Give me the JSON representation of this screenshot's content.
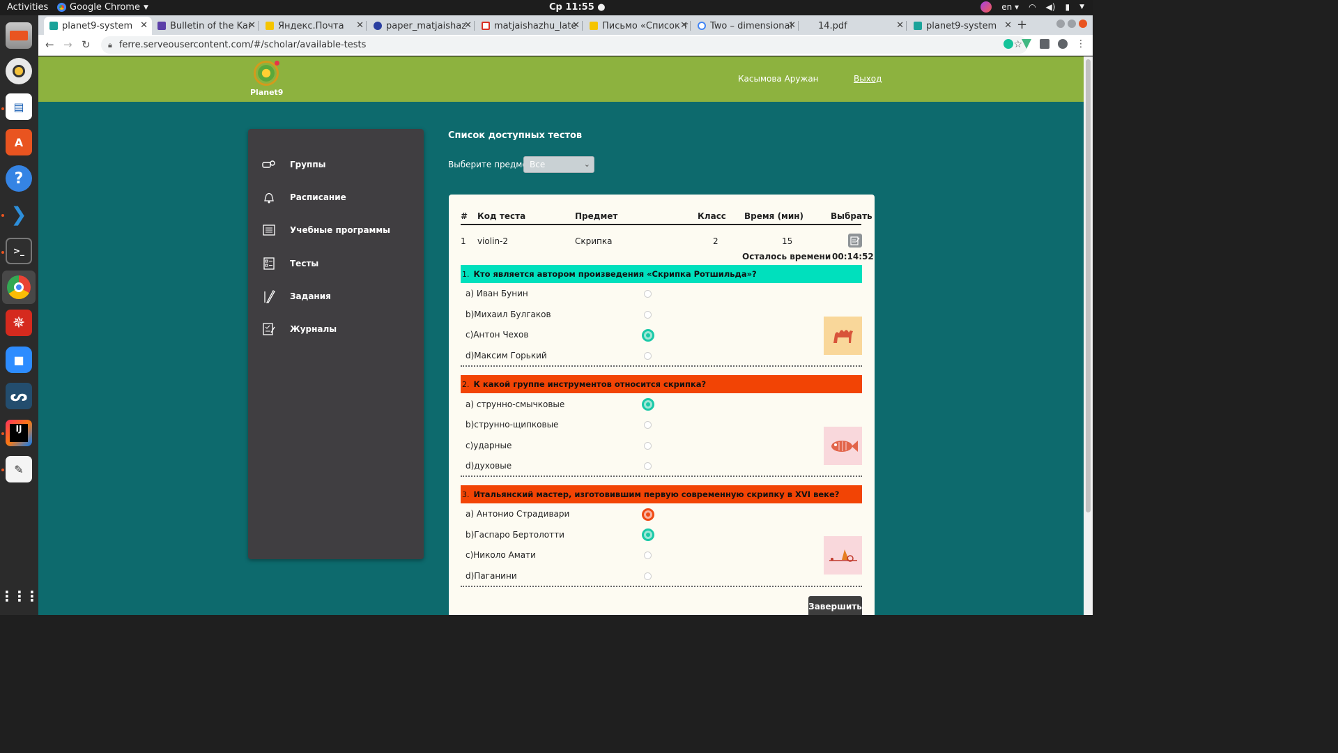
{
  "os": {
    "activities": "Activities",
    "app_name": "Google Chrome",
    "clock": "Ср 11:55 ●",
    "lang": "en ▾"
  },
  "browser": {
    "tabs": [
      {
        "title": "planet9-system",
        "color": "#1aa39a"
      },
      {
        "title": "Bulletin of the Kar",
        "color": "#5b3fa8"
      },
      {
        "title": "Яндекс.Почта",
        "color": "#f5c400"
      },
      {
        "title": "paper_matjaishaz",
        "color": "#2a3fa0"
      },
      {
        "title": "matjaishazhu_late",
        "color": "#d93025"
      },
      {
        "title": "Письмо «Список т",
        "color": "#f5c400"
      },
      {
        "title": "Two – dimensional",
        "color": "#4285f4"
      },
      {
        "title": "14.pdf",
        "color": "#d6dbe0"
      },
      {
        "title": "planet9-system",
        "color": "#1aa39a"
      }
    ],
    "url": "ferre.serveousercontent.com/#/scholar/available-tests"
  },
  "site": {
    "logo_text": "Planet9",
    "user_name": "Касымова Аружан",
    "logout": "Выход"
  },
  "sidebar": {
    "items": [
      {
        "label": "Группы",
        "icon": "group-icon"
      },
      {
        "label": "Расписание",
        "icon": "bell-icon"
      },
      {
        "label": "Учебные программы",
        "icon": "curriculum-icon"
      },
      {
        "label": "Тесты",
        "icon": "test-list-icon"
      },
      {
        "label": "Задания",
        "icon": "pencil-icon"
      },
      {
        "label": "Журналы",
        "icon": "journal-icon"
      }
    ]
  },
  "main": {
    "title": "Список доступных тестов",
    "filter_label": "Выберите предмет:",
    "filter_value": "Все",
    "table": {
      "headers": {
        "num": "#",
        "code": "Код теста",
        "subject": "Предмет",
        "grade": "Класс",
        "time": "Время (мин)",
        "select": "Выбрать"
      },
      "rows": [
        {
          "num": "1",
          "code": "violin-2",
          "subject": "Скрипка",
          "grade": "2",
          "time": "15"
        }
      ]
    },
    "time_left_label": "Осталось времени",
    "time_left_value": "00:14:52",
    "finish_button": "Завершить"
  },
  "questions": [
    {
      "num": "1.",
      "text": "Кто является автором произведения «Скрипка Ротшильда»?",
      "bar_color": "#00e0bd",
      "image": "camel-icon",
      "options": [
        {
          "label": "a) Иван Бунин",
          "state": "none"
        },
        {
          "label": "b)Михаил Булгаков",
          "state": "none"
        },
        {
          "label": "c)Антон Чехов",
          "state": "selected"
        },
        {
          "label": "d)Максим Горький",
          "state": "none"
        }
      ]
    },
    {
      "num": "2.",
      "text": "К какой группе инструментов относится скрипка?",
      "bar_color": "#f24405",
      "image": "fish-icon",
      "options": [
        {
          "label": "a) струнно-смычковые",
          "state": "selected"
        },
        {
          "label": "b)струнно-щипковые",
          "state": "none"
        },
        {
          "label": "c)ударные",
          "state": "none"
        },
        {
          "label": "d)духовые",
          "state": "none"
        }
      ]
    },
    {
      "num": "3.",
      "text": "Итальянский мастер, изготовившим первую современную скрипку в XVI веке?",
      "bar_color": "#f24405",
      "image": "boat-icon",
      "options": [
        {
          "label": "a) Антонио Страдивари",
          "state": "wrong"
        },
        {
          "label": "b)Гаспаро Бертолотти",
          "state": "selected"
        },
        {
          "label": "c)Николо Амати",
          "state": "none"
        },
        {
          "label": "d)Паганини",
          "state": "none"
        }
      ]
    }
  ]
}
